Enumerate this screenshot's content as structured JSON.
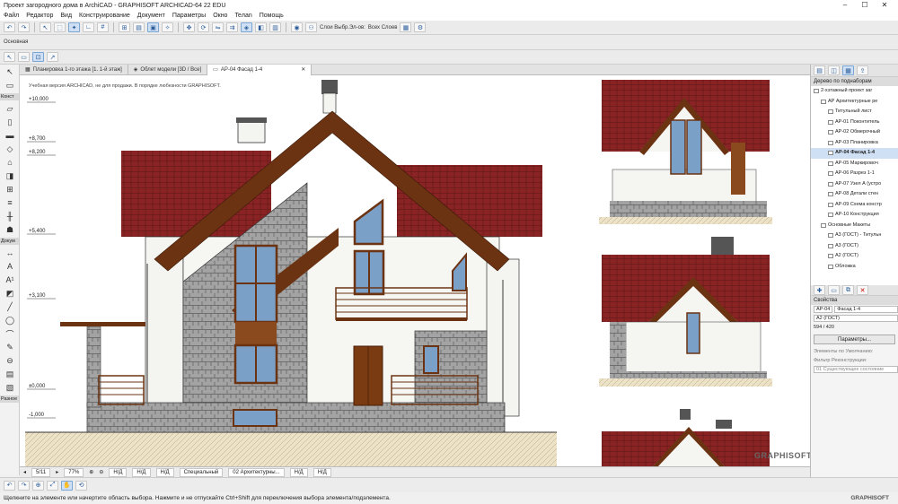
{
  "window": {
    "title": "Проект загородного дома в ArchiCAD - GRAPHISOFT ARCHICAD-64 22 EDU"
  },
  "menu": [
    "Файл",
    "Редактор",
    "Вид",
    "Конструирование",
    "Документ",
    "Параметры",
    "Окно",
    "Teлan",
    "Помощь"
  ],
  "toolbar2": {
    "layer_label": "Слои Выбр.Эл-ов:",
    "all_layers": "Всех Слоев"
  },
  "toolbar3": {
    "label": "Основная"
  },
  "tabs": [
    {
      "label": "Планировка 1-го этажа [1. 1-й этаж]"
    },
    {
      "label": "Облет модели [3D / Все]"
    },
    {
      "label": "АР-04 Фасад 1-4"
    }
  ],
  "canvas": {
    "note": "Учебная версия ARCHICAD, не для продажи. В порядке любезности GRAPHISOFT."
  },
  "levels": [
    "+10,000",
    "+8,700",
    "+8,200",
    "+5,400",
    "+3,100",
    "±0,000",
    "-1,000"
  ],
  "left_toolbox": {
    "groups": [
      "Конст",
      "Докум",
      "Разное"
    ]
  },
  "status": {
    "page": "5/11",
    "zoom": "77%",
    "nd1": "Н/Д",
    "nd2": "Н/Д",
    "nd3": "Н/Д",
    "special": "Специальный",
    "view": "02 Архитектурны...",
    "nd4": "Н/Д",
    "nd5": "Н/Д"
  },
  "hint": "Щелкните на элементе или начертите область выбора. Нажмите и не отпускайте Ctrl+Shift для переключения выбора элемента/подэлемента.",
  "watermark": "GRAPHISOFT",
  "watermark2": "GRAPHISOFT.",
  "navigator": {
    "title": "Дерево по поднаборам",
    "items": [
      {
        "label": "2-хэтажный проект заг",
        "indent": 0,
        "selected": false
      },
      {
        "label": "АР Архитектурные ре",
        "indent": 1,
        "selected": false
      },
      {
        "label": "Титульный лист",
        "indent": 2,
        "selected": false
      },
      {
        "label": "АР-01 Поконтитель",
        "indent": 2,
        "selected": false
      },
      {
        "label": "АР-02 Обмерочный",
        "indent": 2,
        "selected": false
      },
      {
        "label": "АР-03 Планировка",
        "indent": 2,
        "selected": false
      },
      {
        "label": "АР-04 Фасад 1-4",
        "indent": 2,
        "selected": true
      },
      {
        "label": "АР-05 Маркировоч",
        "indent": 2,
        "selected": false
      },
      {
        "label": "АР-06 Разрез 1-1",
        "indent": 2,
        "selected": false
      },
      {
        "label": "АР-07 Узел А (устро",
        "indent": 2,
        "selected": false
      },
      {
        "label": "АР-08 Детали стен",
        "indent": 2,
        "selected": false
      },
      {
        "label": "АР-09 Схема констр",
        "indent": 2,
        "selected": false
      },
      {
        "label": "АР-10 Конструкция",
        "indent": 2,
        "selected": false
      },
      {
        "label": "Основные Макеты",
        "indent": 1,
        "selected": false
      },
      {
        "label": "А3 (ГОСТ) - Титульн",
        "indent": 2,
        "selected": false
      },
      {
        "label": "А3 (ГОСТ)",
        "indent": 2,
        "selected": false
      },
      {
        "label": "А2 (ГОСТ)",
        "indent": 2,
        "selected": false
      },
      {
        "label": "Обложка",
        "indent": 2,
        "selected": false
      }
    ]
  },
  "properties": {
    "title": "Свойства",
    "id": "АР-04",
    "name": "Фасад 1-4",
    "layout": "А2 (ГОСТ)",
    "size": "594 / 420",
    "button": "Параметры...",
    "defaults": "Элементы по Умолчанию:",
    "filter_label": "Фильтр Реконструкции:",
    "filter_value": "01 Существующее состояние"
  },
  "colors": {
    "roof": "#8a2424",
    "wood": "#6b3312",
    "stone": "#9b9b9b",
    "glass": "#7aa0c8",
    "ground": "#e8dcc0"
  }
}
